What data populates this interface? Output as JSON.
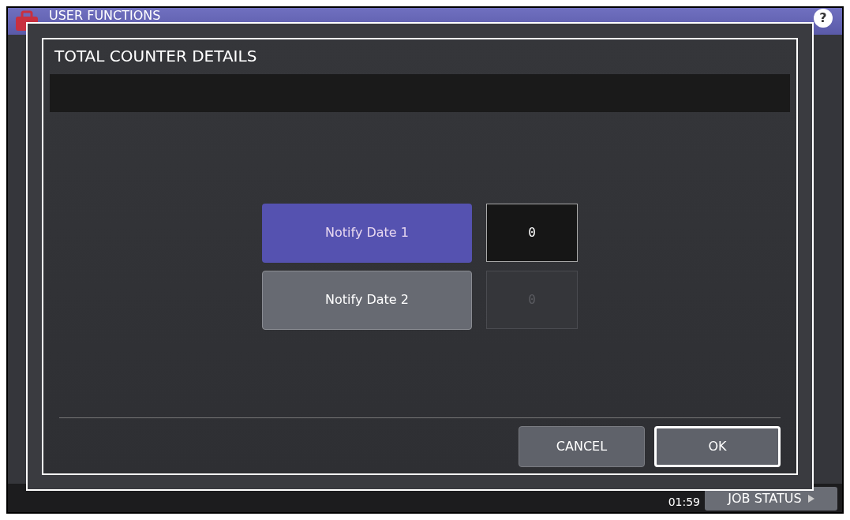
{
  "header": {
    "title": "USER FUNCTIONS",
    "help_button": "?"
  },
  "status_bar": {
    "time": "01:59",
    "job_status_button": "JOB STATUS"
  },
  "dialog": {
    "title": "TOTAL COUNTER DETAILS",
    "options": [
      {
        "label": "Notify Date 1",
        "value": "0",
        "selected": true
      },
      {
        "label": "Notify Date 2",
        "value": "0",
        "selected": false
      }
    ],
    "buttons": [
      {
        "label": "CANCEL",
        "kind": "cancel"
      },
      {
        "label": "OK",
        "kind": "ok"
      }
    ]
  }
}
